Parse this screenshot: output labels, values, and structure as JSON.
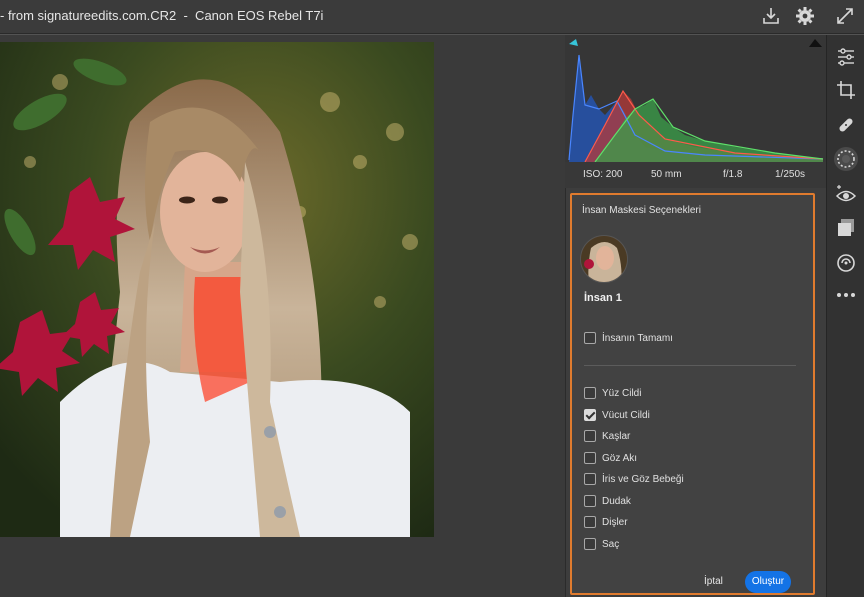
{
  "window": {
    "title": "- from signatureedits.com.CR2  -  Canon EOS Rebel T7i"
  },
  "toolbar": {
    "icons": [
      "save-icon",
      "gear-icon",
      "fullscreen-icon"
    ]
  },
  "tools": {
    "icons": [
      "edit-sliders-icon",
      "crop-icon",
      "heal-icon",
      "masking-icon",
      "redeye-icon",
      "presets-icon",
      "snapshots-icon",
      "more-icon"
    ]
  },
  "exif": {
    "iso": "ISO: 200",
    "focal": "50 mm",
    "aperture": "f/1.8",
    "shutter": "1/250s"
  },
  "dialog": {
    "title": "İnsan Maskesi Seçenekleri",
    "person_label": "İnsan 1",
    "entire_person": "İnsanın Tamamı",
    "options": [
      {
        "label": "Yüz Cildi",
        "checked": false
      },
      {
        "label": "Vücut Cildi",
        "checked": true
      },
      {
        "label": "Kaşlar",
        "checked": false
      },
      {
        "label": "Göz Akı",
        "checked": false
      },
      {
        "label": "İris ve Göz Bebeği",
        "checked": false
      },
      {
        "label": "Dudak",
        "checked": false
      },
      {
        "label": "Dişler",
        "checked": false
      },
      {
        "label": "Saç",
        "checked": false
      }
    ],
    "cancel_label": "İptal",
    "create_label": "Oluştur"
  },
  "colors": {
    "accent": "#1473e6",
    "highlight_border": "#e07b2e",
    "mask_overlay": "#ff3b1f"
  }
}
